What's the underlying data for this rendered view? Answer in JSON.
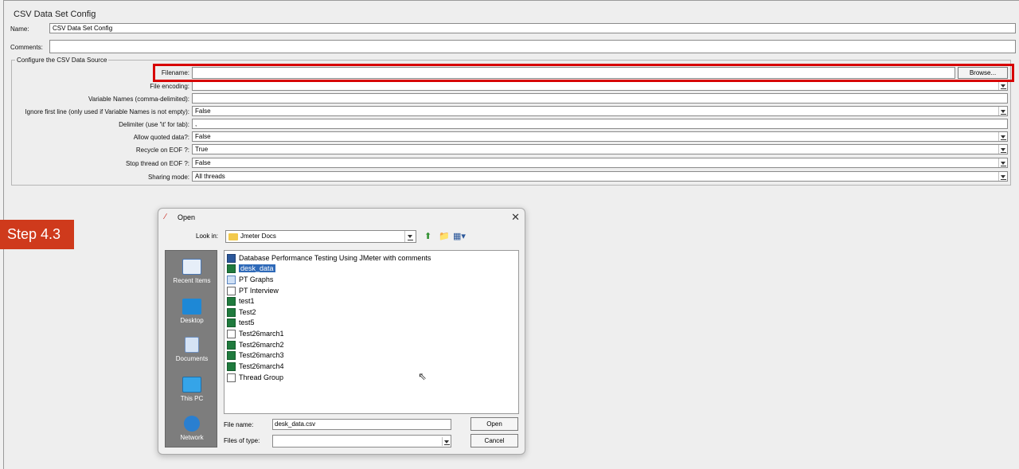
{
  "config": {
    "title": "CSV Data Set Config",
    "name_label": "Name:",
    "name_value": "CSV Data Set Config",
    "comments_label": "Comments:",
    "comments_value": "",
    "group_title": "Configure the CSV Data Source",
    "browse_label": "Browse...",
    "fields": [
      {
        "label": "Filename:",
        "value": ""
      },
      {
        "label": "File encoding:",
        "value": ""
      },
      {
        "label": "Variable Names (comma-delimited):",
        "value": ""
      },
      {
        "label": "Ignore first line (only used if Variable Names is not empty):",
        "value": "False"
      },
      {
        "label": "Delimiter (use '\\t' for tab):",
        "value": ","
      },
      {
        "label": "Allow quoted data?:",
        "value": "False"
      },
      {
        "label": "Recycle on EOF ?:",
        "value": "True"
      },
      {
        "label": "Stop thread on EOF ?:",
        "value": "False"
      },
      {
        "label": "Sharing mode:",
        "value": "All threads"
      }
    ]
  },
  "step_badge": "Step 4.3",
  "dialog": {
    "title": "Open",
    "close_glyph": "✕",
    "look_in_label": "Look in:",
    "look_in_value": "Jmeter Docs",
    "places": [
      "Recent Items",
      "Desktop",
      "Documents",
      "This PC",
      "Network"
    ],
    "files": [
      {
        "name": "Database Performance Testing Using JMeter with comments",
        "icon": "word-icon"
      },
      {
        "name": "desk_data",
        "icon": "excel-icon",
        "selected": true
      },
      {
        "name": "PT Graphs",
        "icon": "document-icon"
      },
      {
        "name": "PT Interview",
        "icon": "text-file-icon"
      },
      {
        "name": "test1",
        "icon": "excel-icon"
      },
      {
        "name": "Test2",
        "icon": "excel-icon"
      },
      {
        "name": "test5",
        "icon": "excel-icon"
      },
      {
        "name": "Test26march1",
        "icon": "file-icon"
      },
      {
        "name": "Test26march2",
        "icon": "excel-icon"
      },
      {
        "name": "Test26march3",
        "icon": "excel-icon"
      },
      {
        "name": "Test26march4",
        "icon": "excel-icon"
      },
      {
        "name": "Thread Group",
        "icon": "file-icon"
      }
    ],
    "file_name_label": "File name:",
    "file_name_value": "desk_data.csv",
    "files_of_type_label": "Files of type:",
    "files_of_type_value": "",
    "open_label": "Open",
    "cancel_label": "Cancel"
  },
  "colors": {
    "highlight_border": "#d70000",
    "step_badge_bg": "#cf3a1c",
    "selection": "#2e69b8"
  }
}
